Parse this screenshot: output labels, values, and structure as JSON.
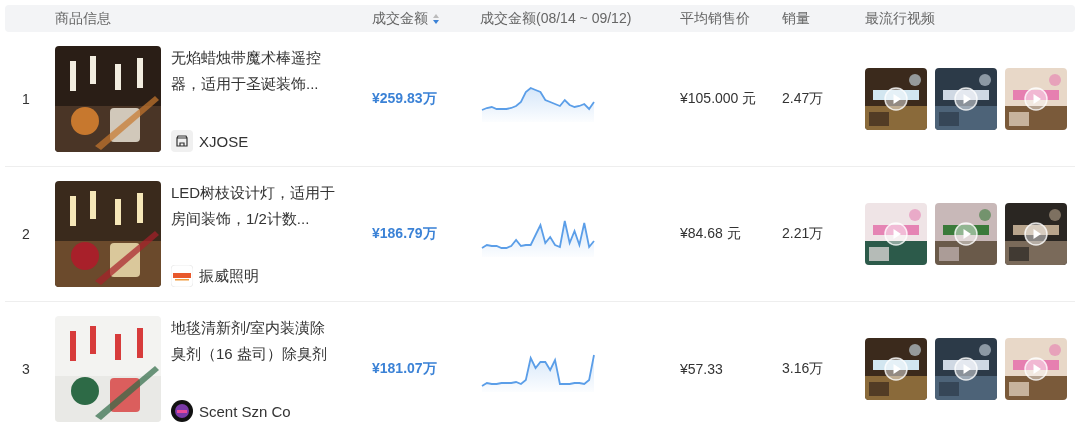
{
  "table": {
    "columns": [
      {
        "label": "商品信息",
        "sortable": false
      },
      {
        "label": "成交金额",
        "sortable": true
      },
      {
        "label": "成交金额(08/14 ~ 09/12)",
        "sortable": false
      },
      {
        "label": "平均销售价",
        "sortable": false
      },
      {
        "label": "销量",
        "sortable": false
      },
      {
        "label": "最流行视频",
        "sortable": false
      }
    ],
    "rows": [
      {
        "rank": "1",
        "title": "无焰蜡烛带魔术棒遥控器，适用于圣诞装饰...",
        "shop": "XJOSE",
        "amount": "¥259.83万",
        "price": "¥105.000 元",
        "sales": "2.47万"
      },
      {
        "rank": "2",
        "title": "LED树枝设计灯，适用于房间装饰，1/2计数...",
        "shop": "振威照明",
        "amount": "¥186.79万",
        "price": "¥84.68 元",
        "sales": "2.21万"
      },
      {
        "rank": "3",
        "title": "地毯清新剂/室内装潢除臭剂（16 盎司）除臭剂",
        "shop": "Scent Szn Co",
        "amount": "¥181.07万",
        "price": "¥57.33",
        "sales": "3.16万"
      }
    ]
  }
}
